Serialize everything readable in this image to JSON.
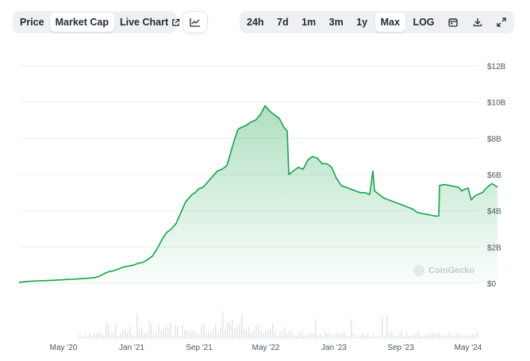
{
  "toolbar": {
    "left_tabs": [
      {
        "label": "Price",
        "active": false
      },
      {
        "label": "Market Cap",
        "active": true
      },
      {
        "label": "Live Chart",
        "active": false
      }
    ],
    "chart_icon": "line-chart-icon",
    "ranges": [
      {
        "label": "24h",
        "active": false
      },
      {
        "label": "7d",
        "active": false
      },
      {
        "label": "1m",
        "active": false
      },
      {
        "label": "3m",
        "active": false
      },
      {
        "label": "1y",
        "active": false
      },
      {
        "label": "Max",
        "active": true
      },
      {
        "label": "LOG",
        "active": false
      }
    ],
    "icons": [
      "calendar-icon",
      "download-icon",
      "fullscreen-icon"
    ]
  },
  "watermark": {
    "text": "CoinGecko"
  },
  "chart_data": {
    "type": "area",
    "y_ticks": [
      "$12B",
      "$10B",
      "$8B",
      "$6B",
      "$4B",
      "$2B",
      "$0"
    ],
    "ylim": [
      0,
      12
    ],
    "x_ticks": [
      "May '20",
      "Jan '21",
      "Sep '21",
      "May '22",
      "Jan '23",
      "Sep '23",
      "May '24"
    ],
    "series": [
      {
        "values_b": [
          [
            0,
            0.05
          ],
          [
            6,
            0.08
          ],
          [
            12,
            0.1
          ],
          [
            18,
            0.12
          ],
          [
            24,
            0.13
          ],
          [
            30,
            0.14
          ],
          [
            36,
            0.15
          ],
          [
            42,
            0.16
          ],
          [
            48,
            0.18
          ],
          [
            54,
            0.19
          ],
          [
            60,
            0.21
          ],
          [
            66,
            0.22
          ],
          [
            72,
            0.23
          ],
          [
            78,
            0.25
          ],
          [
            84,
            0.27
          ],
          [
            90,
            0.29
          ],
          [
            96,
            0.32
          ],
          [
            102,
            0.4
          ],
          [
            108,
            0.55
          ],
          [
            114,
            0.65
          ],
          [
            120,
            0.7
          ],
          [
            126,
            0.8
          ],
          [
            132,
            0.9
          ],
          [
            138,
            0.95
          ],
          [
            144,
            1.0
          ],
          [
            150,
            1.1
          ],
          [
            156,
            1.15
          ],
          [
            162,
            1.3
          ],
          [
            168,
            1.5
          ],
          [
            174,
            1.9
          ],
          [
            180,
            2.4
          ],
          [
            186,
            2.8
          ],
          [
            192,
            3.0
          ],
          [
            198,
            3.3
          ],
          [
            204,
            3.9
          ],
          [
            210,
            4.5
          ],
          [
            214,
            4.7
          ],
          [
            218,
            4.9
          ],
          [
            222,
            5.0
          ],
          [
            226,
            5.2
          ],
          [
            232,
            5.3
          ],
          [
            238,
            5.6
          ],
          [
            244,
            5.9
          ],
          [
            250,
            6.2
          ],
          [
            256,
            6.3
          ],
          [
            262,
            6.5
          ],
          [
            268,
            7.4
          ],
          [
            272,
            8.0
          ],
          [
            276,
            8.5
          ],
          [
            280,
            8.6
          ],
          [
            286,
            8.7
          ],
          [
            292,
            8.9
          ],
          [
            298,
            9.0
          ],
          [
            304,
            9.3
          ],
          [
            310,
            9.8
          ],
          [
            316,
            9.5
          ],
          [
            322,
            9.3
          ],
          [
            328,
            9.1
          ],
          [
            334,
            8.6
          ],
          [
            338,
            8.4
          ],
          [
            340,
            6.0
          ],
          [
            346,
            6.2
          ],
          [
            352,
            6.4
          ],
          [
            358,
            6.3
          ],
          [
            364,
            6.8
          ],
          [
            370,
            7.0
          ],
          [
            376,
            6.9
          ],
          [
            382,
            6.6
          ],
          [
            388,
            6.6
          ],
          [
            394,
            6.4
          ],
          [
            400,
            5.8
          ],
          [
            406,
            5.4
          ],
          [
            412,
            5.3
          ],
          [
            418,
            5.2
          ],
          [
            424,
            5.1
          ],
          [
            430,
            5.0
          ],
          [
            436,
            5.0
          ],
          [
            442,
            4.9
          ],
          [
            446,
            6.2
          ],
          [
            448,
            5.1
          ],
          [
            454,
            4.9
          ],
          [
            460,
            4.7
          ],
          [
            466,
            4.6
          ],
          [
            472,
            4.5
          ],
          [
            478,
            4.4
          ],
          [
            484,
            4.3
          ],
          [
            490,
            4.2
          ],
          [
            496,
            4.1
          ],
          [
            502,
            3.9
          ],
          [
            508,
            3.85
          ],
          [
            514,
            3.8
          ],
          [
            520,
            3.75
          ],
          [
            526,
            3.7
          ],
          [
            529,
            3.72
          ],
          [
            530,
            5.4
          ],
          [
            536,
            5.45
          ],
          [
            542,
            5.4
          ],
          [
            548,
            5.35
          ],
          [
            554,
            5.3
          ],
          [
            558,
            5.1
          ],
          [
            562,
            5.2
          ],
          [
            566,
            5.25
          ],
          [
            570,
            4.6
          ],
          [
            574,
            4.8
          ],
          [
            578,
            4.9
          ],
          [
            584,
            5.0
          ],
          [
            590,
            5.3
          ],
          [
            596,
            5.5
          ],
          [
            600,
            5.4
          ],
          [
            603,
            5.3
          ]
        ]
      }
    ],
    "legend": "none"
  }
}
